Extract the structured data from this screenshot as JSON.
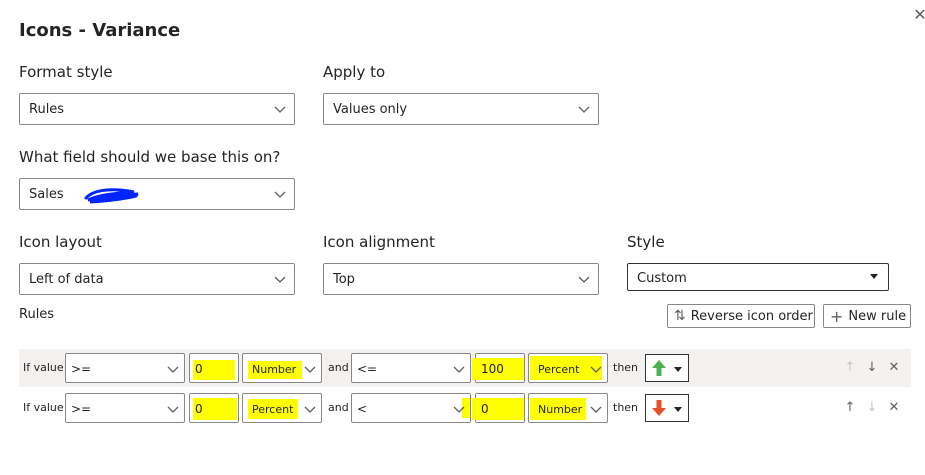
{
  "dialog": {
    "title": "Icons - Variance",
    "close_icon": "✕"
  },
  "format_style": {
    "label": "Format style",
    "value": "Rules"
  },
  "apply_to": {
    "label": "Apply to",
    "value": "Values only"
  },
  "base_field": {
    "label": "What field should we base this on?",
    "value": "Sales"
  },
  "icon_layout": {
    "label": "Icon layout",
    "value": "Left of data"
  },
  "icon_alignment": {
    "label": "Icon alignment",
    "value": "Top"
  },
  "style": {
    "label": "Style",
    "value": "Custom"
  },
  "rules": {
    "label": "Rules",
    "reverse_button": "Reverse icon order",
    "new_rule_button": "New rule",
    "rows": [
      {
        "if_label": "If value",
        "op1": ">=",
        "val1": "0",
        "type1": "Number",
        "and_label": "and",
        "op2": "<=",
        "val2": "100",
        "type2": "Percent",
        "then_label": "then",
        "icon": "green-up-arrow-icon",
        "icon_color": "#4caf50"
      },
      {
        "if_label": "If value",
        "op1": ">=",
        "val1": "0",
        "type1": "Percent",
        "and_label": "and",
        "op2": "<",
        "val2": "0",
        "type2": "Number",
        "then_label": "then",
        "icon": "red-down-arrow-icon",
        "icon_color": "#e8502b"
      }
    ]
  },
  "colors": {
    "highlight": "#ffff00",
    "row_shade": "#f3f2f1",
    "border": "#8a8886",
    "redaction_scribble": "#0026ff"
  }
}
